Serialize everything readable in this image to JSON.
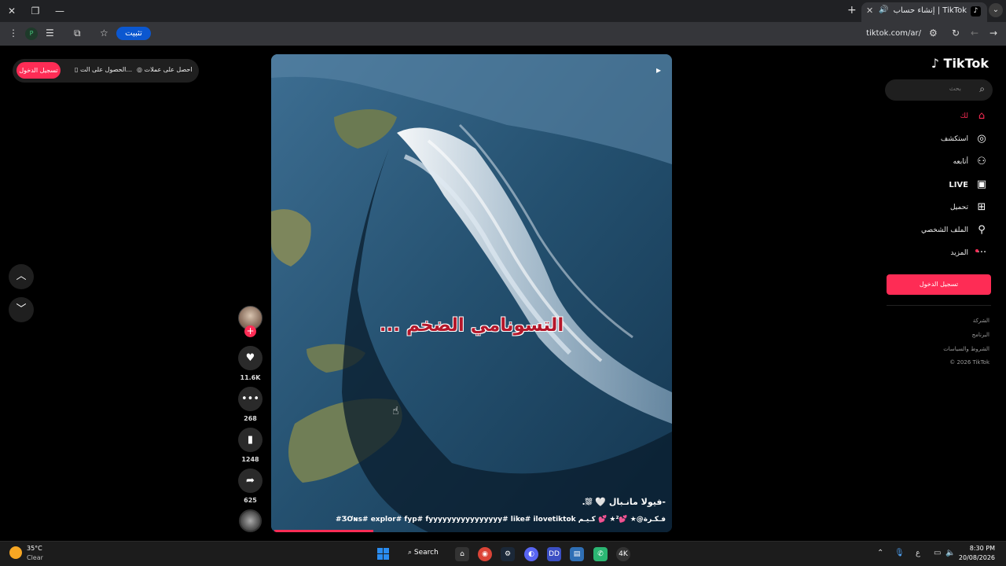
{
  "browser": {
    "tab_title": "إنشاء حساب | TikTok",
    "url": "tiktok.com/ar/",
    "install_label": "تثبيت"
  },
  "top_pills": {
    "login": "تسجيل الدخول",
    "get_app": "الحصول على الت...",
    "get_coins": "احصل على عملات"
  },
  "video": {
    "overlay_text": "التسونامي الضخم ...",
    "caption_user": "-فيولا مانـبال 🤍 ⛆.",
    "caption_tags": "فـكـرة@★ 💕²★ 💕 كـيـم ƷƠɴs# explor# fyp# fyyyyyyyyyyyyyyyy# like# ilovetiktok#",
    "progress": 0.25
  },
  "actions": {
    "likes": "11.6K",
    "comments": "268",
    "saves": "1248",
    "shares": "625"
  },
  "sidebar": {
    "logo": "TikTok",
    "search_placeholder": "بحث",
    "nav": [
      {
        "label": "لك",
        "icon": "home-icon"
      },
      {
        "label": "استكشف",
        "icon": "compass-icon"
      },
      {
        "label": "أتابعه",
        "icon": "user-plus-icon"
      },
      {
        "label": "LIVE",
        "icon": "tv-icon"
      },
      {
        "label": "تحميل",
        "icon": "upload-icon"
      },
      {
        "label": "الملف الشخصي",
        "icon": "profile-icon"
      },
      {
        "label": "المزيد",
        "icon": "more-icon"
      }
    ],
    "login_button": "تسجيل الدخول",
    "footer": [
      "الشركة",
      "البرنامج",
      "الشروط والسياسات",
      "© 2026 TikTok"
    ]
  },
  "taskbar": {
    "temperature": "35°C",
    "weather": "Clear",
    "search_label": "Search",
    "time": "8:30 PM",
    "date": "20/08/2026",
    "lang": "ع"
  },
  "colors": {
    "accent": "#fe2c55",
    "background": "#000000"
  }
}
